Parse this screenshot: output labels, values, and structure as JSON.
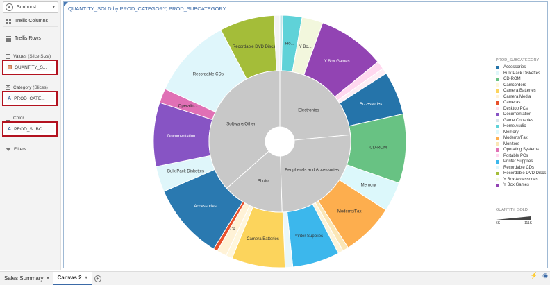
{
  "left_panel": {
    "viz_type": "Sunburst",
    "trellis_columns": "Trellis Columns",
    "trellis_rows": "Trellis Rows",
    "values_label": "Values (Slice Size)",
    "values_item": "QUANTITY_S...",
    "category_label": "Category (Slices)",
    "category_item": "PROD_CATE...",
    "color_label": "Color",
    "color_item": "PROD_SUBC...",
    "filters": "Filters"
  },
  "canvas": {
    "title": "QUANTITY_SOLD by PROD_CATEGORY, PROD_SUBCATEGORY"
  },
  "chart_data": {
    "type": "sunburst",
    "title": "QUANTITY_SOLD by PROD_CATEGORY, PROD_SUBCATEGORY",
    "inner_ring_color": "#c8c8c8",
    "inner": [
      {
        "label": "Electronics",
        "value": 23.5
      },
      {
        "label": "Peripherals and Accessories",
        "value": 26
      },
      {
        "label": "Photo",
        "value": 14
      },
      {
        "label": "Software/Other",
        "value": 36.5
      }
    ],
    "outer": [
      {
        "label": "",
        "value": 0.5,
        "color": "#c3e6ea"
      },
      {
        "label": "Ho...",
        "value": 3.3,
        "color": "#5fd2d8"
      },
      {
        "label": "Y Bo...",
        "value": 3.6,
        "color": "#f2f7dd"
      },
      {
        "label": "Y Box Games",
        "value": 11.6,
        "color": "#9244b3"
      },
      {
        "label": "",
        "value": 1.4,
        "color": "#ffd8ef"
      },
      {
        "label": "",
        "value": 1.0,
        "color": "#fdeef5"
      },
      {
        "label": "Accessories",
        "value": 7.5,
        "color": "#2574aa"
      },
      {
        "label": "CD-ROM",
        "value": 11.9,
        "color": "#68c283"
      },
      {
        "label": "Memory",
        "value": 5.1,
        "color": "#dcf8fb"
      },
      {
        "label": "Modems/Fax",
        "value": 9.1,
        "color": "#fdae4e"
      },
      {
        "label": "",
        "value": 1.0,
        "color": "#fbe6b5"
      },
      {
        "label": "",
        "value": 0.9,
        "color": "#fdf3d7"
      },
      {
        "label": "Printer Supplies",
        "value": 8.1,
        "color": "#3cb7ec"
      },
      {
        "label": "",
        "value": 1.3,
        "color": "#eaf7fa"
      },
      {
        "label": "Camera Batteries",
        "value": 9.2,
        "color": "#fcd45c"
      },
      {
        "label": "",
        "value": 1.1,
        "color": "#fff6dc"
      },
      {
        "label": "Ca...",
        "value": 1.7,
        "color": "#fff2d6"
      },
      {
        "label": "",
        "value": 0.7,
        "color": "#e8502b"
      },
      {
        "label": "Accessories",
        "value": 13.1,
        "color": "#2a79b0"
      },
      {
        "label": "Bulk Pack Diskettes",
        "value": 4.4,
        "color": "#dff6fa"
      },
      {
        "label": "Documentation",
        "value": 11.0,
        "color": "#8754c4"
      },
      {
        "label": "Operatin...",
        "value": 2.5,
        "color": "#e070b5"
      },
      {
        "label": "Recordable CDs",
        "value": 14.0,
        "color": "#dff6fb"
      },
      {
        "label": "Recordable DVD Discs",
        "value": 9.4,
        "color": "#a4bd39"
      },
      {
        "label": "",
        "value": 1.0,
        "color": "#f3f3f3"
      }
    ]
  },
  "legend": {
    "title": "PROD_SUBCATEGORY",
    "items": [
      {
        "label": "Accessories",
        "color": "#2574aa"
      },
      {
        "label": "Bulk Pack Diskettes",
        "color": "#dff6fa"
      },
      {
        "label": "CD-ROM",
        "color": "#68c283"
      },
      {
        "label": "Camcorders",
        "color": "#fff6dc"
      },
      {
        "label": "Camera Batteries",
        "color": "#fcd45c"
      },
      {
        "label": "Camera Media",
        "color": "#fff2d6"
      },
      {
        "label": "Cameras",
        "color": "#e8502b"
      },
      {
        "label": "Desktop PCs",
        "color": "#fde1ee"
      },
      {
        "label": "Documentation",
        "color": "#8754c4"
      },
      {
        "label": "Game Consoles",
        "color": "#d6e4ea"
      },
      {
        "label": "Home Audio",
        "color": "#5fd2d8"
      },
      {
        "label": "Memory",
        "color": "#dcf8fb"
      },
      {
        "label": "Modems/Fax",
        "color": "#fdae4e"
      },
      {
        "label": "Monitors",
        "color": "#fbe6b5"
      },
      {
        "label": "Operating Systems",
        "color": "#e070b5"
      },
      {
        "label": "Portable PCs",
        "color": "#ffd8ef"
      },
      {
        "label": "Printer Supplies",
        "color": "#3cb7ec"
      },
      {
        "label": "Recordable CDs",
        "color": "#dff6fb"
      },
      {
        "label": "Recordable DVD Discs",
        "color": "#a4bd39"
      },
      {
        "label": "Y Box Accessories",
        "color": "#f2f7dd"
      },
      {
        "label": "Y Box Games",
        "color": "#9244b3"
      }
    ],
    "size_title": "QUANTITY_SOLD",
    "size_min": "6K",
    "size_max": "111K"
  },
  "tabs": [
    {
      "label": "Sales Summary",
      "active": false
    },
    {
      "label": "Canvas 2",
      "active": true
    }
  ]
}
